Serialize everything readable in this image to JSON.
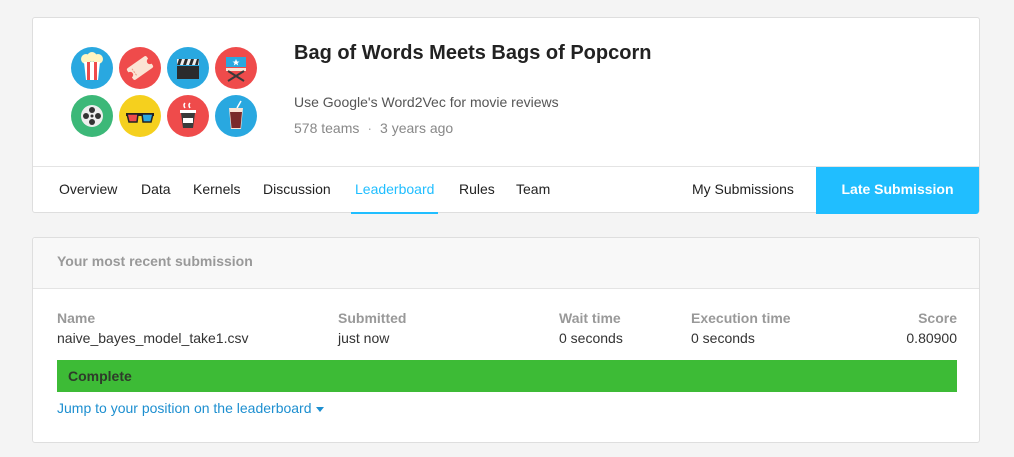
{
  "competition": {
    "title": "Bag of Words Meets Bags of Popcorn",
    "description": "Use Google's Word2Vec for movie reviews",
    "teams": "578 teams",
    "separator": "·",
    "age": "3 years ago"
  },
  "logo_icons": [
    {
      "name": "popcorn-icon",
      "color": "#29a8e0"
    },
    {
      "name": "ticket-icon",
      "color": "#ef4b4b"
    },
    {
      "name": "clapperboard-icon",
      "color": "#29a8e0"
    },
    {
      "name": "directors-chair-icon",
      "color": "#ef4b4b"
    },
    {
      "name": "film-reel-icon",
      "color": "#3cb878"
    },
    {
      "name": "3d-glasses-icon",
      "color": "#f5d01e"
    },
    {
      "name": "coffee-cup-icon",
      "color": "#ef4b4b"
    },
    {
      "name": "soda-cup-icon",
      "color": "#29a8e0"
    }
  ],
  "tabs": {
    "overview": "Overview",
    "data": "Data",
    "kernels": "Kernels",
    "discussion": "Discussion",
    "leaderboard": "Leaderboard",
    "rules": "Rules",
    "team": "Team",
    "my_submissions": "My Submissions",
    "late_submission": "Late Submission",
    "active": "leaderboard"
  },
  "submission": {
    "header": "Your most recent submission",
    "columns": {
      "name": "Name",
      "submitted": "Submitted",
      "wait_time": "Wait time",
      "execution_time": "Execution time",
      "score": "Score"
    },
    "values": {
      "name": "naive_bayes_model_take1.csv",
      "submitted": "just now",
      "wait_time": "0 seconds",
      "execution_time": "0 seconds",
      "score": "0.80900"
    },
    "status": "Complete",
    "status_color": "#3dbb36",
    "jump_link": "Jump to your position on the leaderboard"
  },
  "colors": {
    "accent": "#20beff",
    "link": "#1d8fd0"
  }
}
